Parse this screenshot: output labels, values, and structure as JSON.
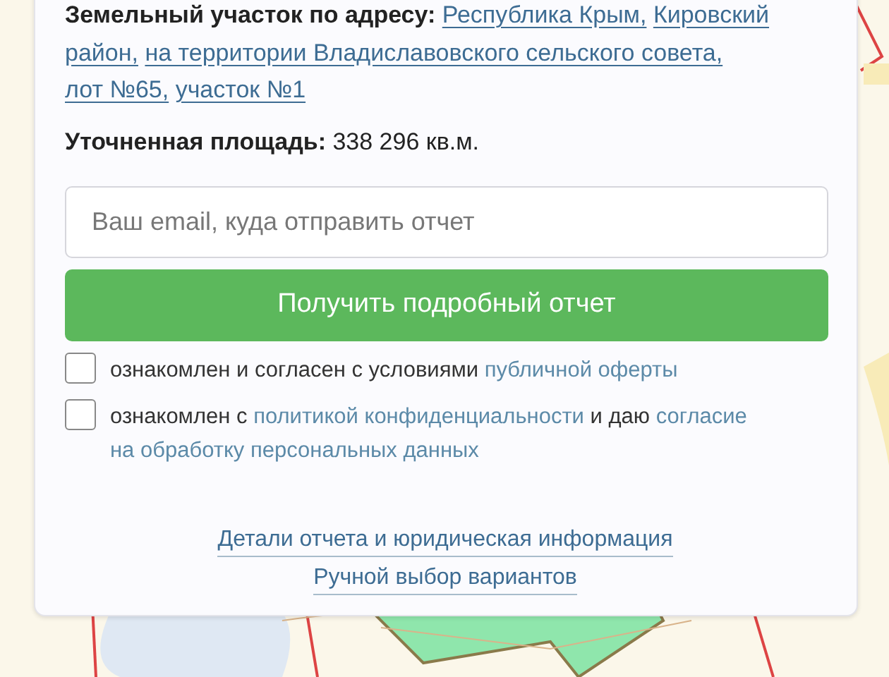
{
  "map": {
    "kind": "picture"
  },
  "plot": {
    "address_label": "Земельный участок по адресу:",
    "address_lines": [
      [
        "Республика Крым,",
        "Кировский"
      ],
      [
        "район,",
        "на территории Владиславовского сельского совета,"
      ],
      [
        "лот №65,",
        "участок №1"
      ]
    ],
    "area_label": "Уточненная площадь:",
    "area_value": "338 296 кв.м."
  },
  "email": {
    "placeholder": "Ваш email, куда отправить отчет"
  },
  "submit": "Получить подробный отчет",
  "consents": [
    {
      "checked": false,
      "parts": [
        {
          "text": "ознакомлен и согласен с условиями",
          "kind": "text"
        },
        {
          "text": "публичной оферты",
          "kind": "link"
        }
      ]
    },
    {
      "checked": false,
      "parts": [
        {
          "text": "ознакомлен с",
          "kind": "text"
        },
        {
          "text": "политикой конфиденциальности",
          "kind": "link"
        },
        {
          "text": "и даю",
          "kind": "text"
        },
        {
          "text": "согласие",
          "kind": "link"
        },
        {
          "text": "на обработку персональных данных",
          "kind": "link"
        }
      ]
    }
  ],
  "links": [
    "Детали отчета и юридическая информация",
    "Ручной выбор вариантов"
  ]
}
